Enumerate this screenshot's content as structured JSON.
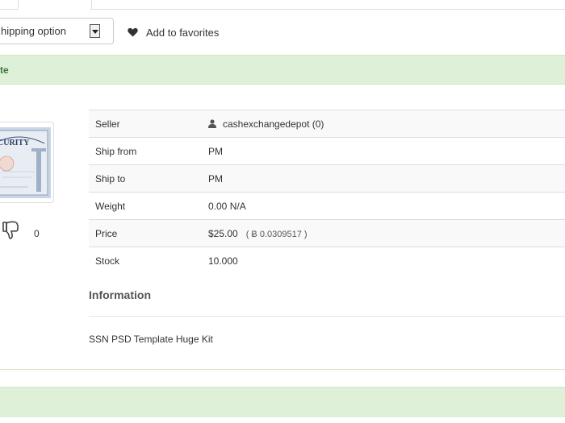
{
  "shipping": {
    "selected": "hipping option"
  },
  "favorites": {
    "label": "Add to favorites",
    "icon": "heart-icon"
  },
  "alert": {
    "text": "te",
    "color": "#dff0d8"
  },
  "feedback": {
    "count": "0",
    "icon": "thumbs-down-icon"
  },
  "details": {
    "seller_label": "Seller",
    "seller_value": "cashexchangedepot (0)",
    "ship_from_label": "Ship from",
    "ship_from_value": "PM",
    "ship_to_label": "Ship to",
    "ship_to_value": "PM",
    "weight_label": "Weight",
    "weight_value": "0.00 N/A",
    "price_label": "Price",
    "price_value": "$25.00",
    "price_btc": "( Ƀ 0.0309517 )",
    "stock_label": "Stock",
    "stock_value": "10.000"
  },
  "information": {
    "title": "Information",
    "text": "SSN PSD Template Huge Kit"
  },
  "image_text": "CURITY"
}
